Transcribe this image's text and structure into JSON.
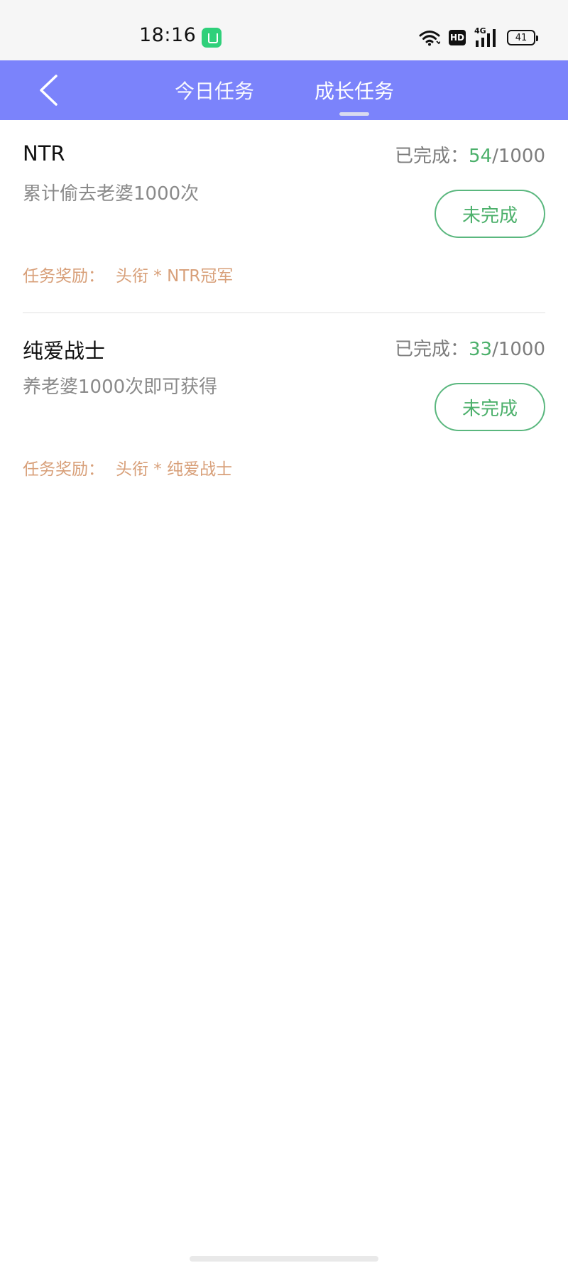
{
  "status_bar": {
    "time": "18:16",
    "hd_label": "HD",
    "network_label": "4G",
    "battery_level": "41"
  },
  "header": {
    "tabs": [
      {
        "label": "今日任务",
        "active": false
      },
      {
        "label": "成长任务",
        "active": true
      }
    ],
    "background_color": "#7b83fb"
  },
  "tasks": [
    {
      "title": "NTR",
      "description": "累计偷去老婆1000次",
      "progress_label": "已完成：",
      "progress_done": "54",
      "progress_total": "/1000",
      "status_label": "未完成",
      "reward_label": "任务奖励：",
      "reward_value": "头衔 * NTR冠军"
    },
    {
      "title": "纯爱战士",
      "description": "养老婆1000次即可获得",
      "progress_label": "已完成：",
      "progress_done": "33",
      "progress_total": "/1000",
      "status_label": "未完成",
      "reward_label": "任务奖励：",
      "reward_value": "头衔 * 纯爱战士"
    }
  ],
  "colors": {
    "accent_green": "#4cb06b",
    "reward_orange": "#d8a07a"
  }
}
